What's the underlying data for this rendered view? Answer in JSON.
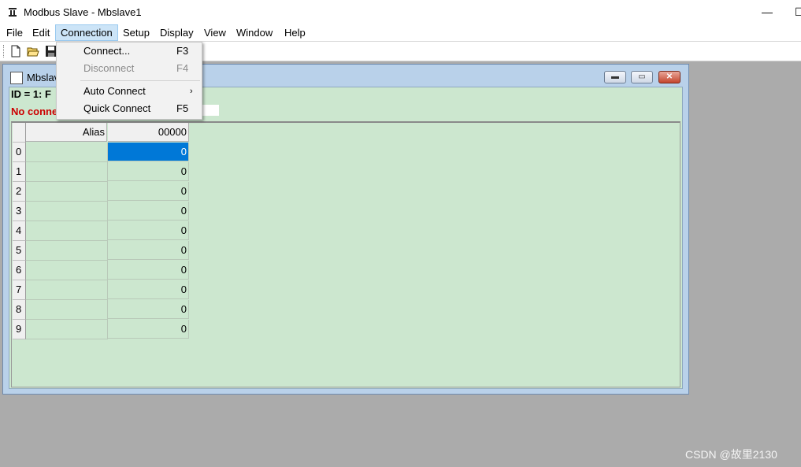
{
  "app": {
    "title": "Modbus Slave - Mbslave1",
    "icon": "modbus-app-icon"
  },
  "window_controls": {
    "minimize": "—",
    "maximize": "☐"
  },
  "menubar": {
    "items": [
      {
        "label": "File"
      },
      {
        "label": "Edit"
      },
      {
        "label": "Connection"
      },
      {
        "label": "Setup"
      },
      {
        "label": "Display"
      },
      {
        "label": "View"
      },
      {
        "label": "Window"
      },
      {
        "label": "Help"
      }
    ],
    "active": "Connection"
  },
  "connection_menu": {
    "items": [
      {
        "label": "Connect...",
        "shortcut": "F3",
        "enabled": true
      },
      {
        "label": "Disconnect",
        "shortcut": "F4",
        "enabled": false
      },
      {
        "label": "Auto Connect",
        "shortcut": "",
        "submenu": true,
        "enabled": true
      },
      {
        "label": "Quick Connect",
        "shortcut": "F5",
        "enabled": true
      }
    ],
    "submenu_arrow": "›"
  },
  "toolbar": {
    "buttons": [
      "new-file-icon",
      "open-folder-icon",
      "save-icon"
    ]
  },
  "mdi_window": {
    "title": "Mbslav",
    "id_line": "ID = 1: F",
    "status": "No conne",
    "controls": {
      "minimize": "▬",
      "restore": "▭",
      "close": "✕"
    }
  },
  "grid": {
    "headers": {
      "alias": "Alias",
      "value": "00000"
    },
    "rows": [
      {
        "index": "0",
        "value": "0",
        "selected": true
      },
      {
        "index": "1",
        "value": "0"
      },
      {
        "index": "2",
        "value": "0"
      },
      {
        "index": "3",
        "value": "0"
      },
      {
        "index": "4",
        "value": "0"
      },
      {
        "index": "5",
        "value": "0"
      },
      {
        "index": "6",
        "value": "0"
      },
      {
        "index": "7",
        "value": "0"
      },
      {
        "index": "8",
        "value": "0"
      },
      {
        "index": "9",
        "value": "0"
      }
    ]
  },
  "watermark": "CSDN @故里2130",
  "colors": {
    "selection": "#0078d7",
    "grid_bg": "#cce7cf",
    "status_red": "#cc0000"
  }
}
